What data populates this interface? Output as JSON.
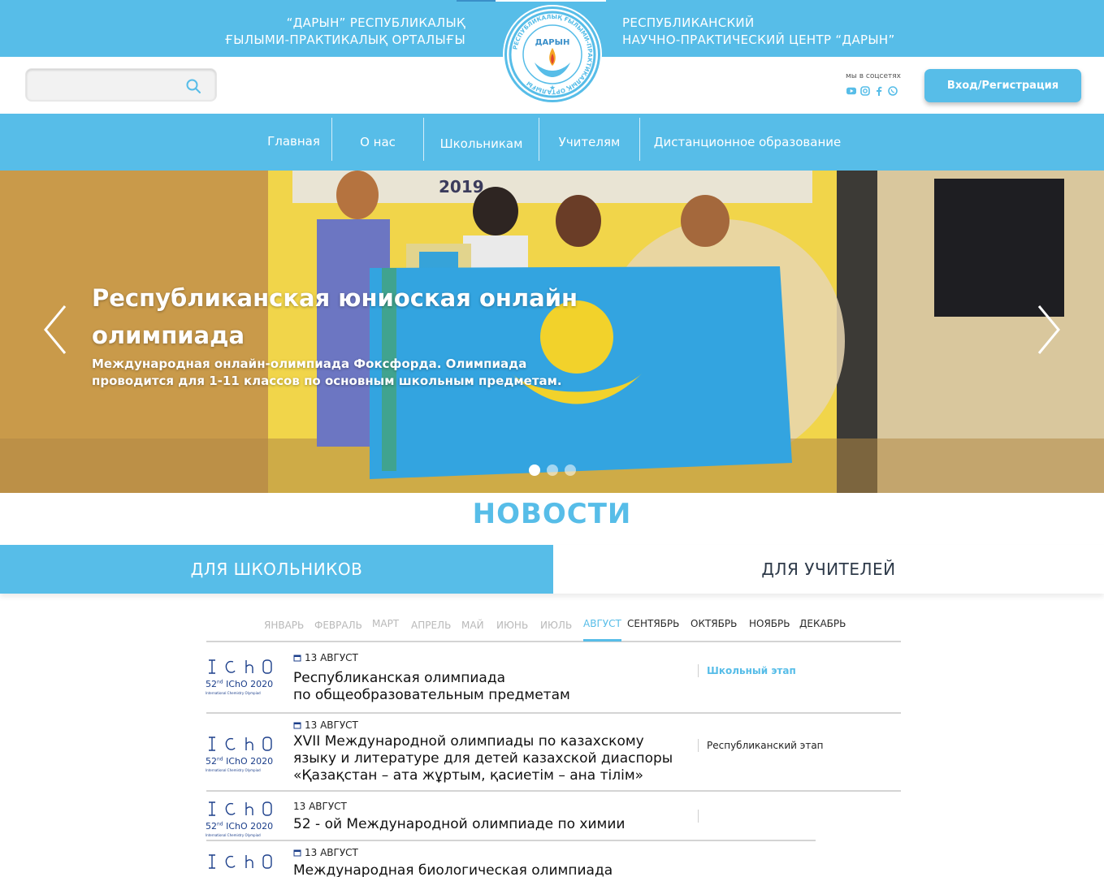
{
  "header": {
    "org_kz_line1": "“ДАРЫН” РЕСПУБЛИКАЛЫҚ",
    "org_kz_line2": "ҒЫЛЫМИ-ПРАКТИКАЛЫҚ ОРТАЛЫҒЫ",
    "org_ru_line1": "РЕСПУБЛИКАНСКИЙ",
    "org_ru_line2": "НАУЧНО-ПРАКТИЧЕСКИЙ ЦЕНТР “ДАРЫН”",
    "logo_center_text": "ДАРЫН",
    "logo_ring_text": "РЕСПУБЛИКАЛЫҚ ҒЫЛЫМИ-ПРАКТИКАЛЫҚ ОРТАЛЫҒЫ"
  },
  "search": {
    "placeholder": "",
    "value": ""
  },
  "social": {
    "label": "мы в соцсетях",
    "icons": [
      "youtube-icon",
      "instagram-icon",
      "facebook-icon",
      "whatsapp-icon"
    ]
  },
  "login": {
    "label": "Вход/Регистрация"
  },
  "nav": {
    "items": [
      "Главная",
      "О нас",
      "Школьникам",
      "Учителям",
      "Дистанционное образование"
    ]
  },
  "hero": {
    "title": "Республиканская юниоская онлайн олимпиада",
    "text": "Международная онлайн-олимпиада Фоксфорда. Олимпиада проводится для 1-11 классов по основным школьным предметам.",
    "banner_text": "2019",
    "slides_total": 3,
    "active_slide": 1
  },
  "news": {
    "title": "НОВОСТИ",
    "tabs": [
      "ДЛЯ ШКОЛЬНИКОВ",
      "ДЛЯ УЧИТЕЛЕЙ"
    ],
    "active_tab": 0,
    "months": [
      "ЯНВАРЬ",
      "ФЕВРАЛЬ",
      "МАРТ",
      "АПРЕЛЬ",
      "МАЙ",
      "ИЮНЬ",
      "ИЮЛЬ",
      "АВГУСТ",
      "СЕНТЯБРЬ",
      "ОКТЯБРЬ",
      "НОЯБРЬ",
      "ДЕКАБРЬ"
    ],
    "active_month": "АВГУСТ",
    "thumb_caption": "52nd IChO 2020",
    "thumb_caption_main": "52",
    "thumb_caption_sup": "nd",
    "thumb_caption_tail": " IChO 2020",
    "thumb_subcaption": "International Chemistry Olympiad",
    "items": [
      {
        "date": "13 АВГУСТ",
        "title_lines": [
          "Республиканская олимпиада",
          "по общеобразовательным предметам"
        ],
        "stage": "Школьный этап"
      },
      {
        "date": "13 АВГУСТ",
        "title_lines": [
          "XVII Международной олимпиады по казахскому",
          "языку и литературе для детей казахской диаспоры",
          "«Қазақстан – ата жұртым, қасиетім – ана тілім»"
        ],
        "stage": "Республиканский этап"
      },
      {
        "date": "13 АВГУСТ",
        "title_lines": [
          "52 - ой Международной олимпиаде по химии"
        ],
        "stage": ""
      },
      {
        "date": "13 АВГУСТ",
        "title_lines": [
          "Международная биологическая олимпиада"
        ],
        "stage": ""
      }
    ]
  },
  "colors": {
    "brand_blue": "#57bde8",
    "past_month": "#b9b9b9",
    "text_dark": "#222222",
    "thumb_navy": "#1b3e8a"
  }
}
